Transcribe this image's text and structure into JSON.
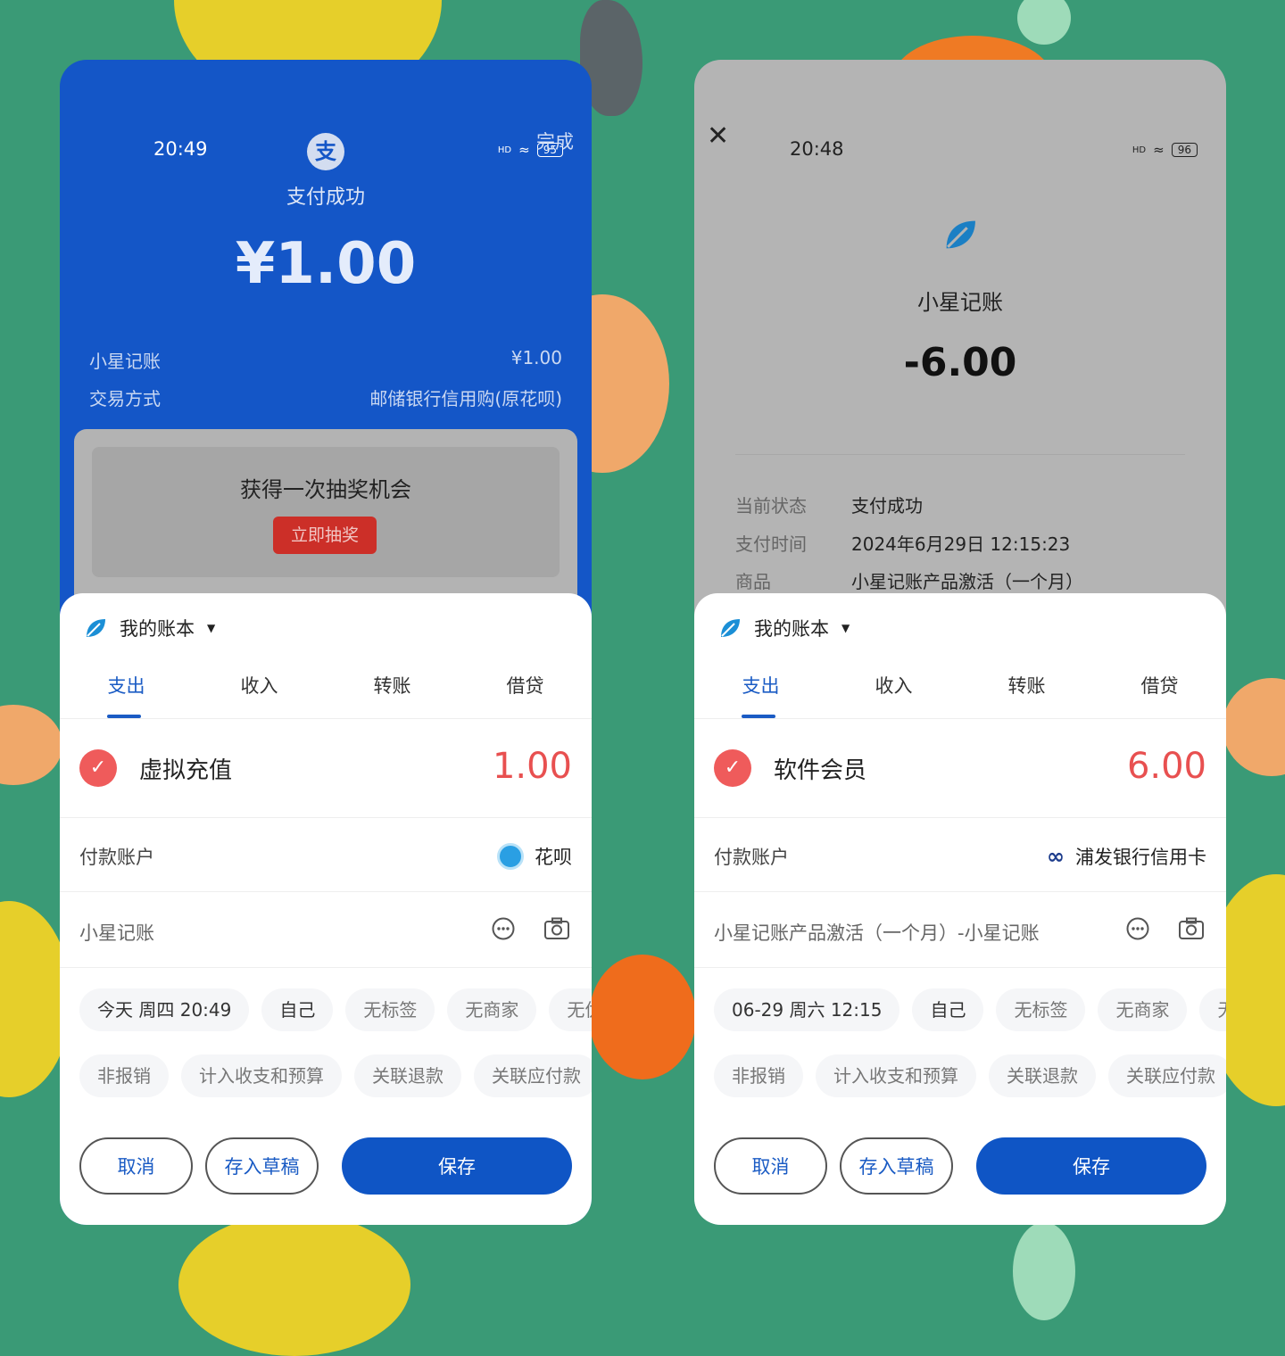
{
  "left": {
    "status": {
      "time": "20:49",
      "signal": "HD",
      "battery": "95"
    },
    "header": {
      "done": "完成",
      "title": "支付成功",
      "amount": "¥1.00"
    },
    "details": {
      "merchant_label": "小星记账",
      "merchant_value": "¥1.00",
      "method_label": "交易方式",
      "method_value": "邮储银行信用购(原花呗)"
    },
    "promo": {
      "title": "获得一次抽奖机会",
      "button": "立即抽奖"
    },
    "sheet": {
      "ledger": "我的账本",
      "tabs": [
        "支出",
        "收入",
        "转账",
        "借贷"
      ],
      "category": "虚拟充值",
      "amount": "1.00",
      "account_label": "付款账户",
      "account_value": "花呗",
      "note": "小星记账",
      "chips1": [
        "今天 周四 20:49",
        "自己",
        "无标签",
        "无商家",
        "无优"
      ],
      "chips2": [
        "非报销",
        "计入收支和预算",
        "关联退款",
        "关联应付款"
      ],
      "cancel": "取消",
      "draft": "存入草稿",
      "save": "保存"
    }
  },
  "right": {
    "status": {
      "time": "20:48",
      "signal": "HD",
      "battery": "96"
    },
    "header": {
      "merchant": "小星记账",
      "amount": "-6.00"
    },
    "details": {
      "status_label": "当前状态",
      "status_value": "支付成功",
      "time_label": "支付时间",
      "time_value": "2024年6月29日 12:15:23",
      "goods_label": "商品",
      "goods_value": "小星记账产品激活（一个月）"
    },
    "sheet": {
      "ledger": "我的账本",
      "tabs": [
        "支出",
        "收入",
        "转账",
        "借贷"
      ],
      "category": "软件会员",
      "amount": "6.00",
      "account_label": "付款账户",
      "account_value": "浦发银行信用卡",
      "note": "小星记账产品激活（一个月）-小星记账",
      "chips1": [
        "06-29 周六 12:15",
        "自己",
        "无标签",
        "无商家",
        "无优"
      ],
      "chips2": [
        "非报销",
        "计入收支和预算",
        "关联退款",
        "关联应付款"
      ],
      "cancel": "取消",
      "draft": "存入草稿",
      "save": "保存"
    }
  },
  "colors": {
    "background": "#3a9a76",
    "alipay_blue": "#1456c7",
    "accent": "#0f55c5",
    "amount_red": "#e85050"
  }
}
